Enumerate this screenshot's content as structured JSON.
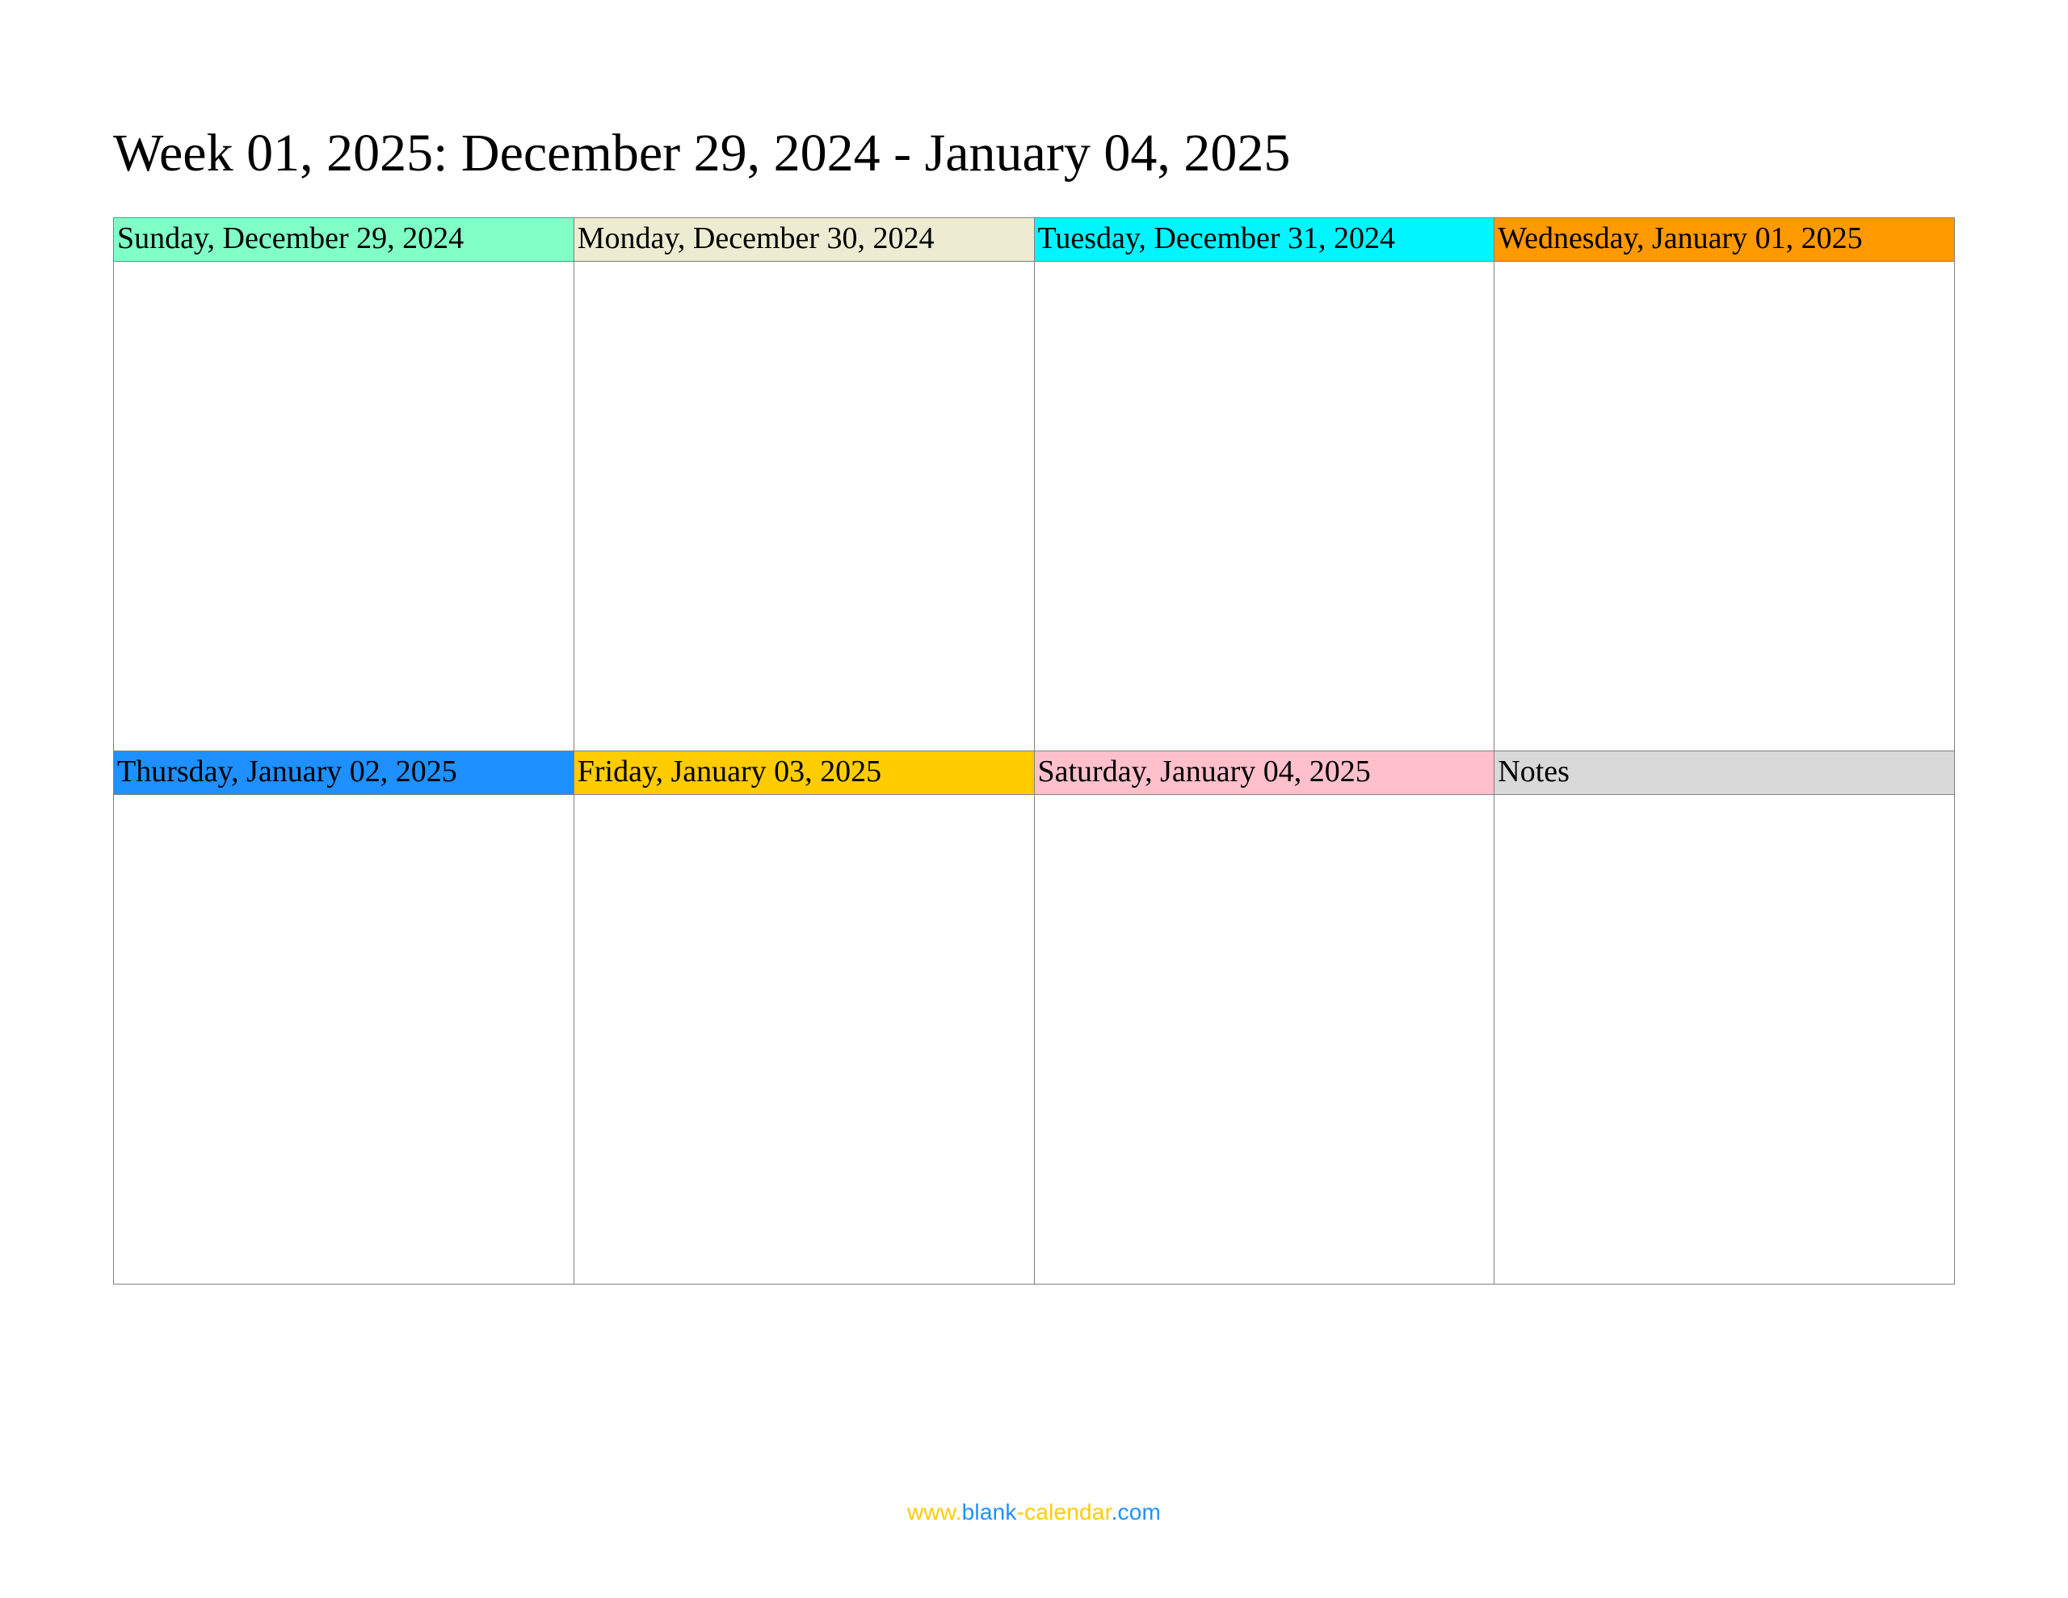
{
  "title": "Week 01, 2025: December 29, 2024 - January 04, 2025",
  "days": {
    "sunday": "Sunday, December 29, 2024",
    "monday": "Monday, December 30, 2024",
    "tuesday": "Tuesday, December 31, 2024",
    "wednesday": "Wednesday, January 01, 2025",
    "thursday": "Thursday, January 02, 2025",
    "friday": "Friday, January 03, 2025",
    "saturday": "Saturday, January 04, 2025",
    "notes": "Notes"
  },
  "footer": {
    "www": "www.",
    "blank": "blank",
    "cal": "-calendar",
    "com": ".com"
  }
}
